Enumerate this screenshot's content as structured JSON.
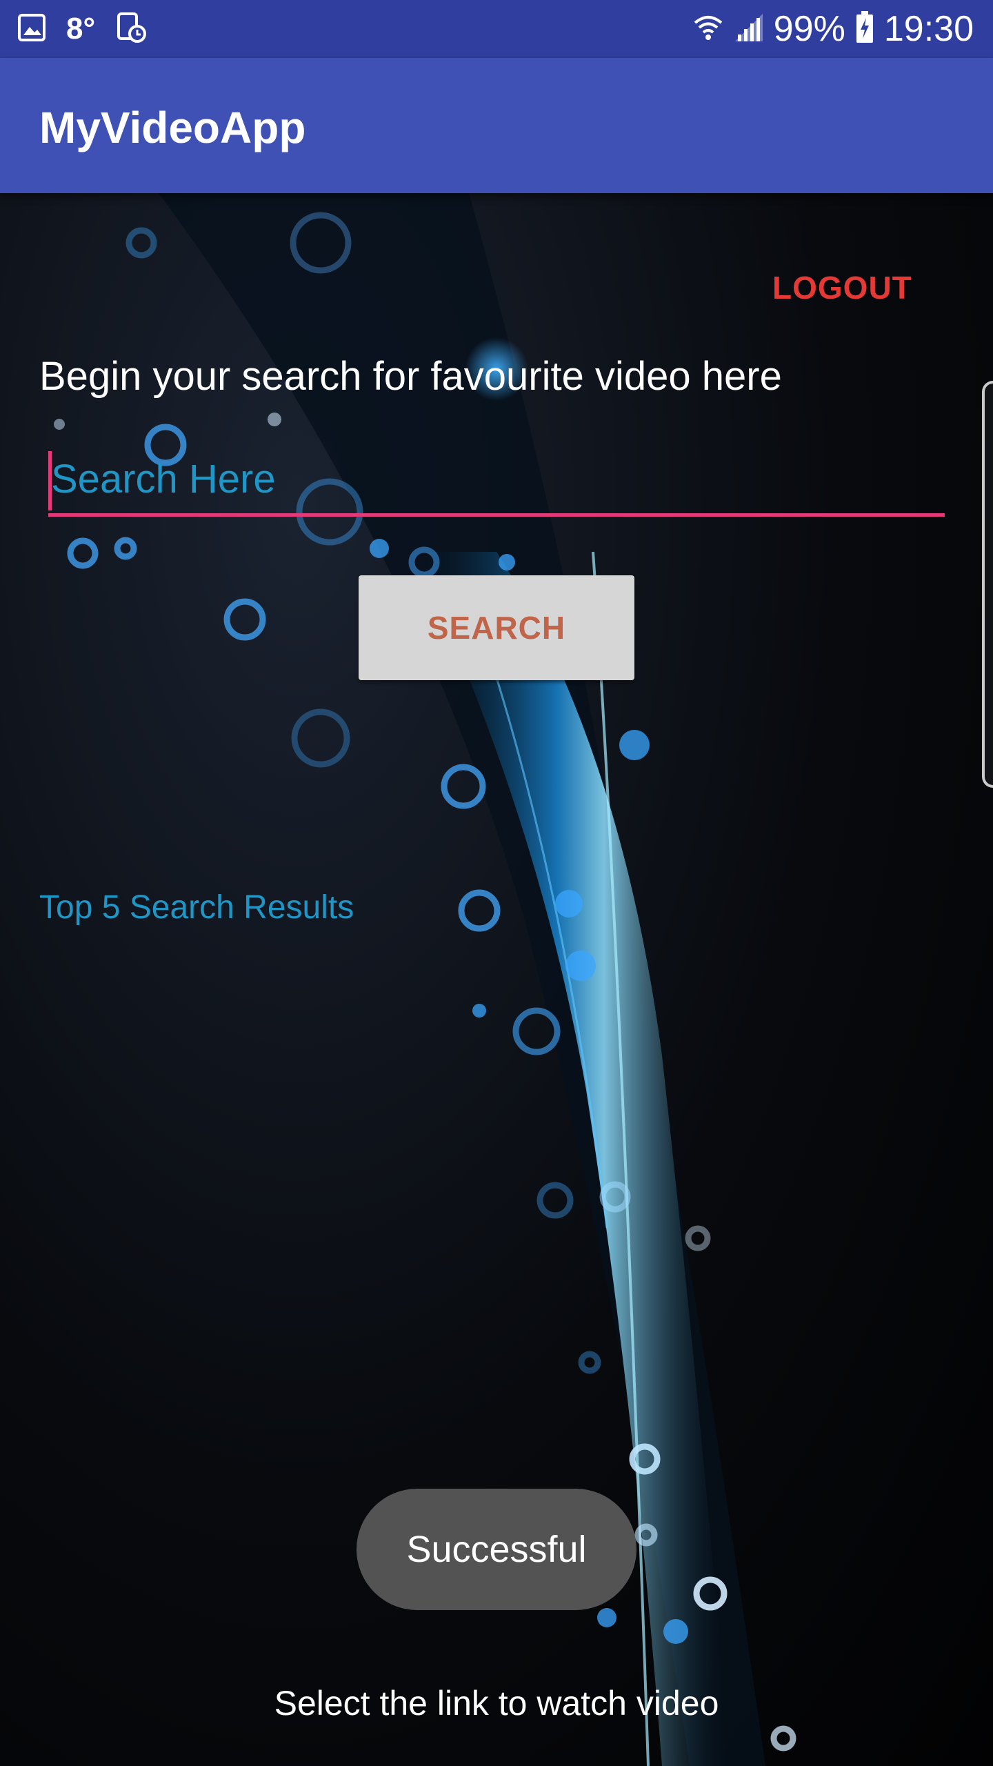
{
  "status_bar": {
    "icons_left": [
      "gallery-icon",
      "weather-icon",
      "screen-time-icon"
    ],
    "temperature": "8°",
    "battery": "99%",
    "time": "19:30",
    "icons_right": [
      "wifi-icon",
      "signal-icon",
      "battery-charging-icon"
    ]
  },
  "app_bar": {
    "title": "MyVideoApp"
  },
  "main": {
    "logout_label": "LOGOUT",
    "intro_text": "Begin your search for favourite video here",
    "search": {
      "placeholder": "Search Here",
      "value": ""
    },
    "search_button_label": "SEARCH",
    "results_label": "Top 5 Search Results",
    "toast": "Successful",
    "footer_text": "Select the link to watch video"
  },
  "colors": {
    "status_bar": "#303f9f",
    "app_bar": "#3f51b5",
    "accent": "#e5397a",
    "logout": "#e53935",
    "link_blue": "#1f96c6",
    "button_bg": "#d6d6d6",
    "button_text": "#c0654a"
  }
}
